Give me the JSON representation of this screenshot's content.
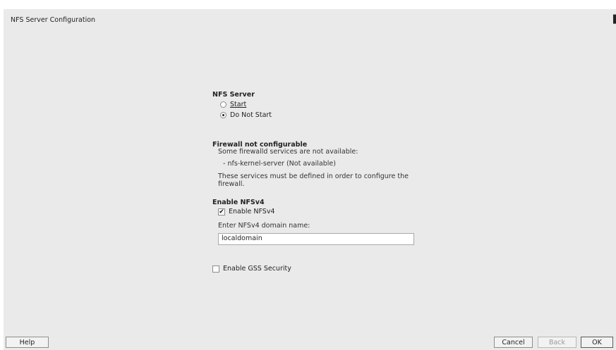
{
  "window": {
    "title": "NFS Server Configuration"
  },
  "nfs_server": {
    "heading": "NFS Server",
    "options": [
      {
        "label": "Start",
        "checked": false
      },
      {
        "label": "Do Not Start",
        "checked": true
      }
    ]
  },
  "firewall": {
    "heading": "Firewall not configurable",
    "line1": "Some firewalld services are not available:",
    "line2": "- nfs-kernel-server (Not available)",
    "line3": "These services must be defined in order to configure the firewall."
  },
  "nfsv4": {
    "heading": "Enable NFSv4",
    "checkbox_label": "Enable NFSv4",
    "checked": true,
    "domain_label": "Enter NFSv4 domain name:",
    "domain_value": "localdomain"
  },
  "gss": {
    "label": "Enable GSS Security",
    "checked": false
  },
  "buttons": {
    "help": "Help",
    "cancel": "Cancel",
    "back": "Back",
    "ok": "OK"
  }
}
